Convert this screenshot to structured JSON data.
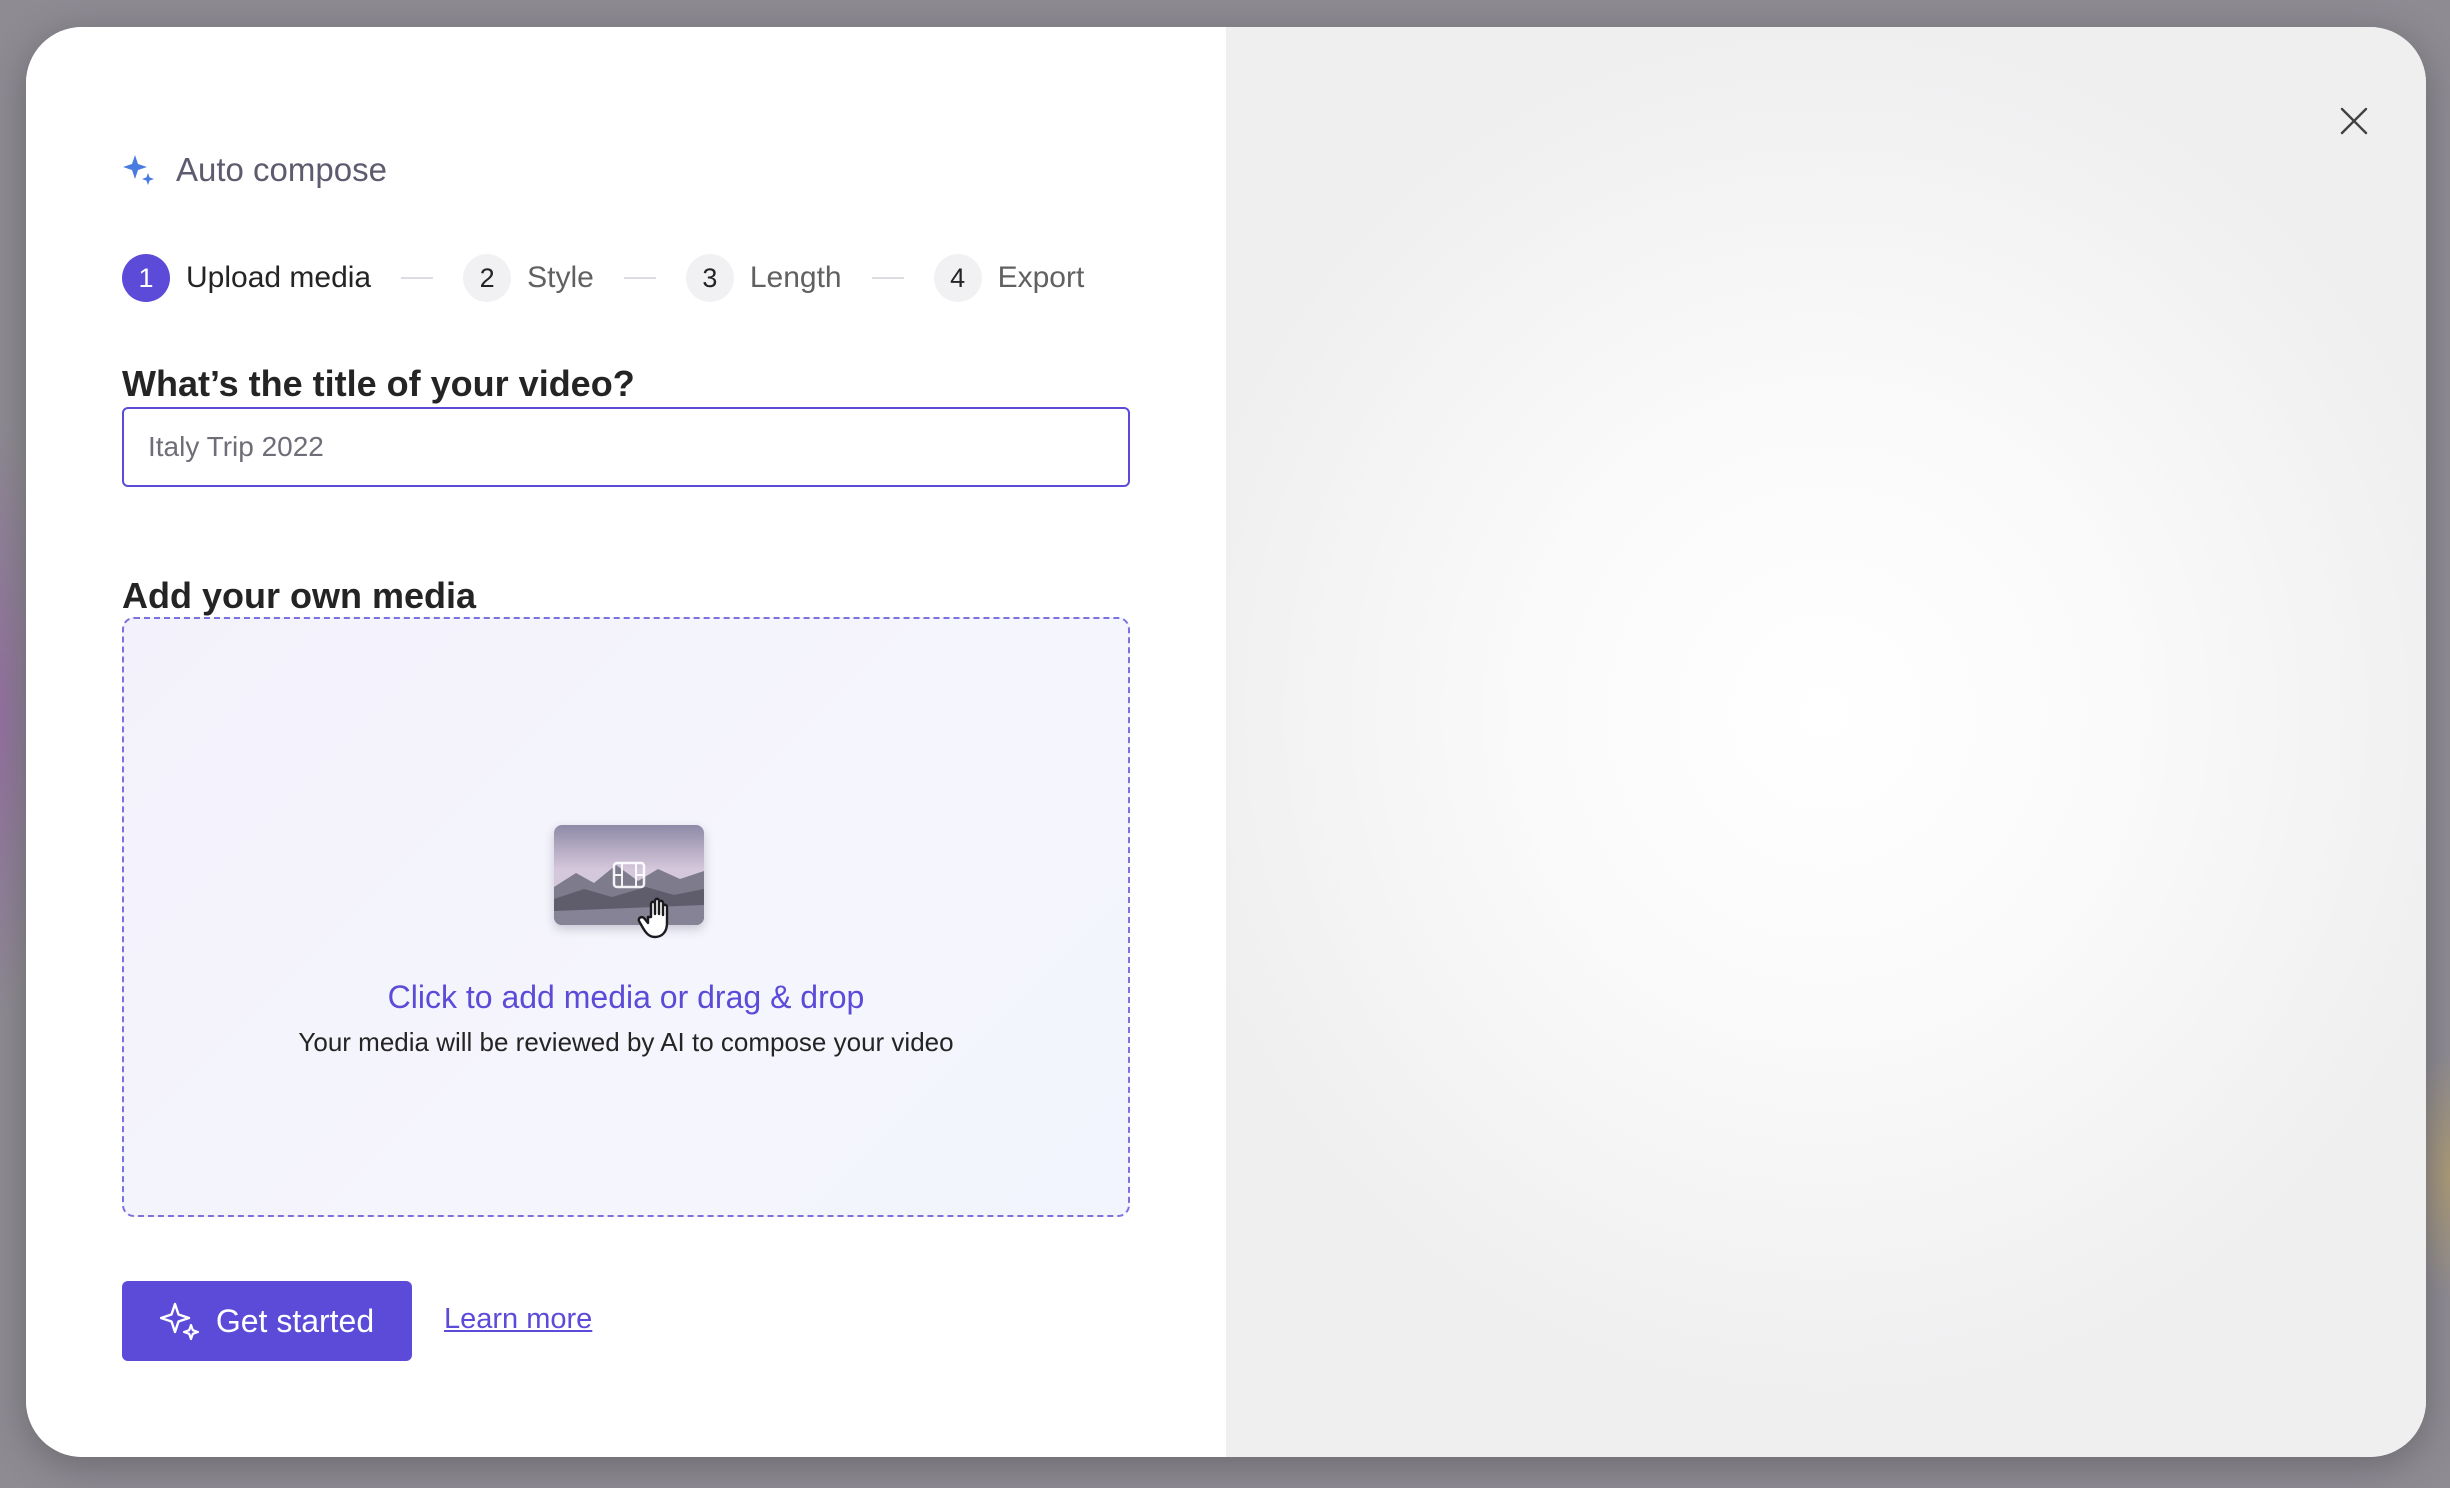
{
  "dialog": {
    "title": "Auto compose",
    "close_icon": "close-icon",
    "header_icon": "sparkle-icon"
  },
  "stepper": {
    "steps": [
      {
        "number": "1",
        "label": "Upload media",
        "active": true
      },
      {
        "number": "2",
        "label": "Style",
        "active": false
      },
      {
        "number": "3",
        "label": "Length",
        "active": false
      },
      {
        "number": "4",
        "label": "Export",
        "active": false
      }
    ]
  },
  "title_section": {
    "heading": "What’s the title of your video?",
    "input_value": "",
    "input_placeholder": "Italy Trip 2022"
  },
  "media_section": {
    "heading": "Add your own media",
    "primary_text": "Click to add media or drag & drop",
    "secondary_text": "Your media will be reviewed by AI to compose your video",
    "thumbnail_icon": "film-icon",
    "cursor_icon": "hand-cursor-icon"
  },
  "actions": {
    "get_started_label": "Get started",
    "get_started_icon": "sparkle-icon",
    "learn_more_label": "Learn more"
  },
  "preview": {
    "icon": "play-icon"
  },
  "colors": {
    "accent": "#5b4bd8",
    "text_primary": "#242424",
    "text_secondary": "#616161",
    "dropzone_border": "#7d72dd"
  }
}
